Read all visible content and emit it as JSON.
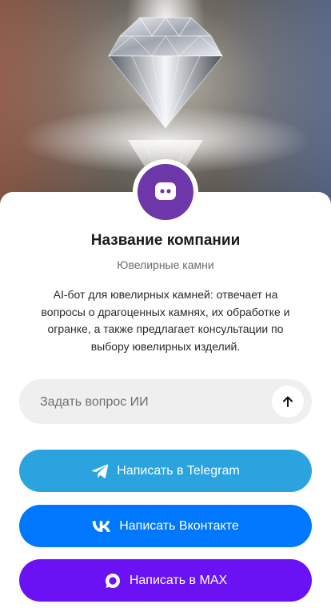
{
  "company": {
    "name": "Название компании",
    "category": "Ювелирные камни",
    "description": "AI-бот для ювелирных камней: отвечает на вопросы о драгоценных камнях, их обработке и огранке, а также предлагает консультации по выбору ювелирных изделий.",
    "avatar_color": "#6d37a9",
    "avatar_icon": "chat-bot-icon"
  },
  "hero": {
    "image": "diamond-photo"
  },
  "ask": {
    "placeholder": "Задать вопрос ИИ",
    "send_icon": "arrow-up-icon"
  },
  "buttons": {
    "telegram": {
      "label": "Написать в Telegram",
      "color": "#2aa3df",
      "icon": "telegram-icon"
    },
    "vk": {
      "label": "Написать Вконтакте",
      "color": "#0077ff",
      "icon": "vk-icon"
    },
    "max": {
      "label": "Написать в MAX",
      "color": "#6b12f5",
      "icon": "max-icon"
    }
  }
}
